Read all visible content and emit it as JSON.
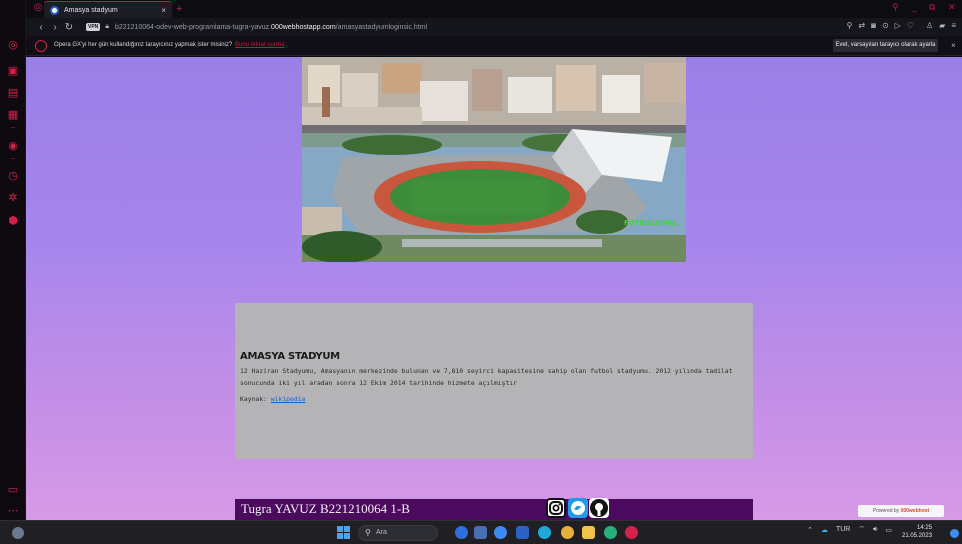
{
  "browser": {
    "tab_title": "Amasya stadyum",
    "tab_close": "×",
    "new_tab": "+",
    "url_prefix": "b221210064-odev-web-programlama-tugra-yavuz.",
    "url_host": "000webhostapp.com",
    "url_path": "/amasyastadyumloginsic.html",
    "vpn_label": "VPN",
    "infobar_message": "Opera GX'yi her gün kullandığınız tarayıcınız yapmak ister misiniz?",
    "infobar_link": "Bunu tekrar sorma",
    "infobar_button": "Evet, varsayılan tarayıcı olarak ayarla",
    "infobar_close": "×"
  },
  "page": {
    "heading": "AMASYA STADYUM",
    "description": "12 Haziran Stadyumu, Amasyanın merkezinde bulunan ve 7,810 seyirci kapasitesine sahip olan futbol stadyumu. 2012 yılında tadilat sonucunda iki yıl aradan sonra 12 Ekim 2014 tarihinde hizmete açılmıştır",
    "source_label": "Kaynak: ",
    "source_link": "wikipedia",
    "image_watermark": "FUTBOLUMAL",
    "footer_text": "Tugra YAVUZ B221210064 1-B",
    "powered_by": "Powered by",
    "powered_brand": "000webhost"
  },
  "taskbar": {
    "search_placeholder": "Ara",
    "lang": "TUR",
    "time": "14:25",
    "date": "21.05.2023"
  },
  "colors": {
    "accent": "#c4193f",
    "footer_bg": "#4c0a5e",
    "box_bg": "#b4b4b6"
  }
}
